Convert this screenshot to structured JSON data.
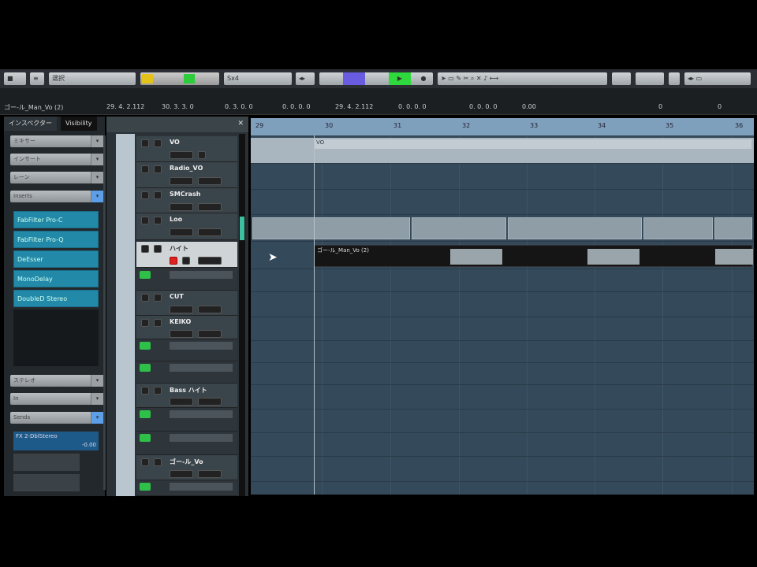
{
  "toolbar": {
    "mode_label": "選択",
    "preset_label": "Sx4"
  },
  "info": {
    "event_name": "ゴー-ル_Man_Vo (2)",
    "values": [
      "29. 4. 2.112",
      "30. 3. 3. 0",
      "0. 3. 0. 0",
      "0. 0. 0. 0",
      "29. 4. 2.112",
      "0. 0. 0. 0",
      "0. 0. 0. 0",
      "0.00",
      "0",
      "0"
    ]
  },
  "inspector": {
    "tabs": [
      "インスペクター",
      "Visibility"
    ],
    "dropdowns": [
      "ミキサー",
      "インサート",
      "レーン",
      "Inserts"
    ],
    "plugins": [
      "FabFilter Pro-C",
      "FabFilter Pro-Q",
      "DeEsser",
      "MonoDelay",
      "DoubleD Stereo"
    ],
    "lower_dropdowns": [
      "ステレオ",
      "In",
      "Sends"
    ],
    "send": {
      "name": "FX 2-DblStereo",
      "value": "-0.00"
    }
  },
  "tracklist": {
    "tracks": [
      "VO",
      "Radio_VO",
      "SMCrash",
      "Loo",
      "ハイト",
      "CUT",
      "KEIKO",
      "Bass ハイト",
      "ゴー-ル_Vo"
    ]
  },
  "ruler": {
    "bars": [
      "29",
      "30",
      "31",
      "32",
      "33",
      "34",
      "35",
      "36"
    ]
  },
  "events": {
    "vo_part": "VO",
    "audio_clip": "ゴー-ル_Man_Vo (2)"
  }
}
